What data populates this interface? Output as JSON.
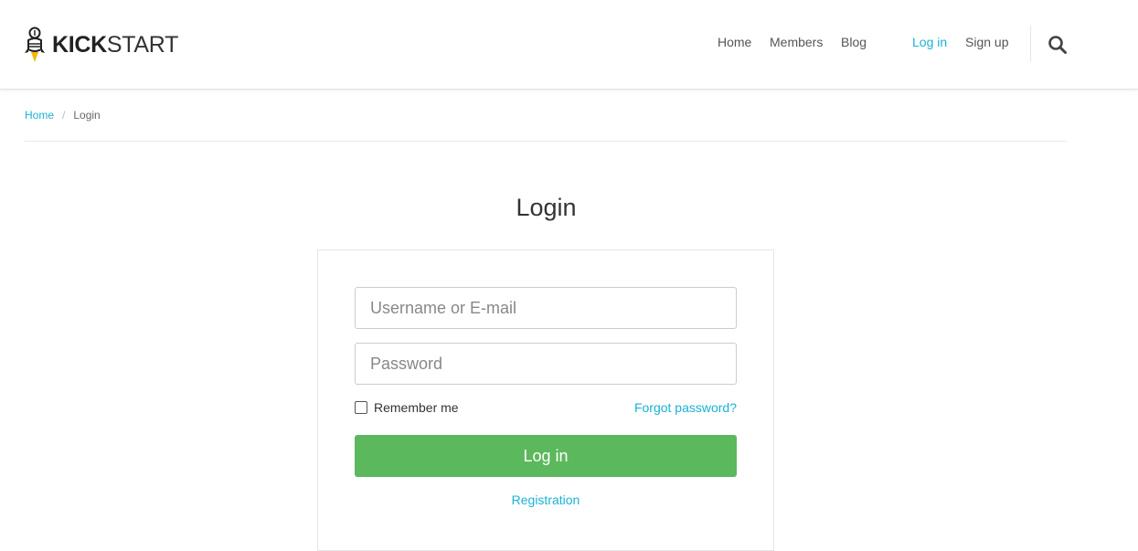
{
  "header": {
    "logo": {
      "bold": "KICK",
      "light": "START",
      "icon": "rocket-bulb-icon"
    },
    "nav": [
      {
        "label": "Home"
      },
      {
        "label": "Members"
      },
      {
        "label": "Blog"
      },
      {
        "label": "Log in",
        "active": true
      },
      {
        "label": "Sign up"
      }
    ],
    "search_icon": "search-icon"
  },
  "breadcrumb": {
    "home": "Home",
    "separator": "/",
    "current": "Login"
  },
  "page": {
    "title": "Login"
  },
  "form": {
    "username_placeholder": "Username or E-mail",
    "password_placeholder": "Password",
    "remember_label": "Remember me",
    "remember_checked": false,
    "forgot_label": "Forgot password?",
    "submit_label": "Log in",
    "registration_label": "Registration"
  },
  "colors": {
    "link": "#1ab2d6",
    "button": "#5cb85c",
    "logo_accent": "#f5b800"
  }
}
